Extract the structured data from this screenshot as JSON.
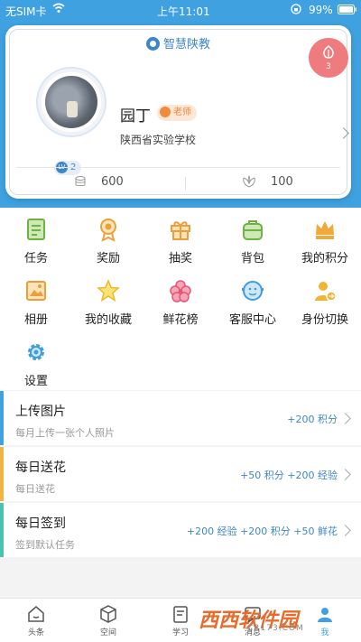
{
  "status_bar": {
    "carrier": "无SIM卡",
    "time": "上午11:01",
    "battery": "99%"
  },
  "header": {
    "app_name": "智慧陕教",
    "flower_count": "3"
  },
  "profile": {
    "name": "园丁",
    "role": "老师",
    "school": "陕西省实验学校",
    "level": "2",
    "level_badge": "LV",
    "coins": "600",
    "flowers": "100"
  },
  "menu": [
    {
      "label": "任务",
      "icon": "task-icon"
    },
    {
      "label": "奖励",
      "icon": "medal-icon"
    },
    {
      "label": "抽奖",
      "icon": "gift-icon"
    },
    {
      "label": "背包",
      "icon": "backpack-icon"
    },
    {
      "label": "我的积分",
      "icon": "crown-icon"
    },
    {
      "label": "相册",
      "icon": "album-icon"
    },
    {
      "label": "我的收藏",
      "icon": "star-icon"
    },
    {
      "label": "鲜花榜",
      "icon": "flower-icon"
    },
    {
      "label": "客服中心",
      "icon": "customer-service-icon"
    },
    {
      "label": "身份切换",
      "icon": "switch-identity-icon"
    },
    {
      "label": "设置",
      "icon": "gear-icon"
    }
  ],
  "tasks": [
    {
      "title": "上传图片",
      "subtitle": "每月上传一张个人照片",
      "reward": "+200 积分",
      "color": "#3fa1df"
    },
    {
      "title": "每日送花",
      "subtitle": "每日送花",
      "reward": "+50 积分 +200 经验",
      "color": "#f1b547"
    },
    {
      "title": "每日签到",
      "subtitle": "签到默认任务",
      "reward": "+200 经验 +200 积分 +50 鲜花",
      "color": "#4cc3b0"
    }
  ],
  "tabbar": [
    {
      "label": "头条"
    },
    {
      "label": "空间"
    },
    {
      "label": "学习"
    },
    {
      "label": "消息"
    },
    {
      "label": "我"
    }
  ],
  "watermark": {
    "brand": "西西软件园",
    "url": "CR173.COM"
  },
  "colors": {
    "accent": "#3fa1df",
    "flower_badge": "#ee7b7d",
    "role_badge": "#f08a3c"
  }
}
